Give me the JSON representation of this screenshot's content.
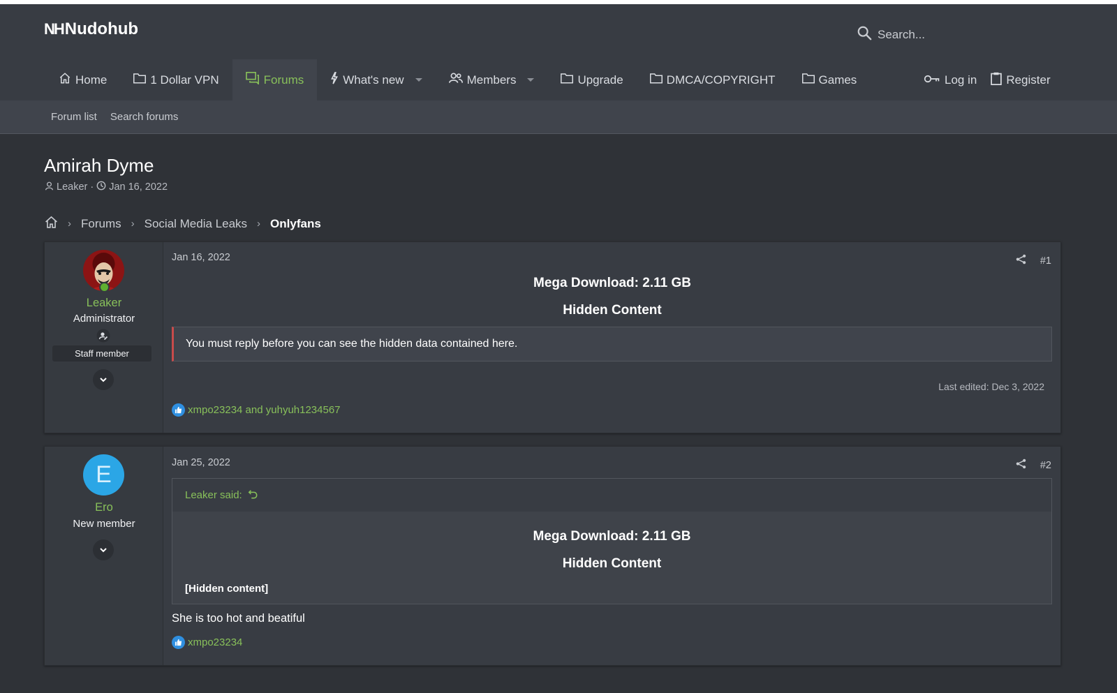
{
  "site": {
    "logo_mark": "NH",
    "logo_text": "Nudohub"
  },
  "search": {
    "placeholder": "Search..."
  },
  "nav": {
    "items": [
      {
        "label": "Home",
        "icon": "home-icon"
      },
      {
        "label": "1 Dollar VPN",
        "icon": "folder-icon"
      },
      {
        "label": "Forums",
        "icon": "forums-icon",
        "active": true
      },
      {
        "label": "What's new",
        "icon": "bolt-icon",
        "dropdown": true
      },
      {
        "label": "Members",
        "icon": "members-icon",
        "dropdown": true
      },
      {
        "label": "Upgrade",
        "icon": "folder-icon"
      },
      {
        "label": "DMCA/COPYRIGHT",
        "icon": "folder-icon"
      },
      {
        "label": "Games",
        "icon": "folder-icon"
      }
    ],
    "login": "Log in",
    "register": "Register"
  },
  "subnav": {
    "forum_list": "Forum list",
    "search_forums": "Search forums"
  },
  "thread": {
    "title": "Amirah Dyme",
    "author": "Leaker",
    "separator": "·",
    "date": "Jan 16, 2022"
  },
  "breadcrumb": {
    "items": [
      "Forums",
      "Social Media Leaks",
      "Onlyfans"
    ]
  },
  "posts": [
    {
      "username": "Leaker",
      "user_title": "Administrator",
      "badge": "Staff member",
      "date": "Jan 16, 2022",
      "number": "#1",
      "headline": "Mega Download: 2.11 GB",
      "subheadline": "Hidden Content",
      "hidden_notice": "You must reply before you can see the hidden data contained here.",
      "last_edited": "Last edited: Dec 3, 2022",
      "reactions": "xmpo23234 and yuhyuh1234567"
    },
    {
      "username": "Ero",
      "avatar_letter": "E",
      "user_title": "New member",
      "date": "Jan 25, 2022",
      "number": "#2",
      "quote_author": "Leaker said:",
      "quote_headline": "Mega Download: 2.11 GB",
      "quote_subheadline": "Hidden Content",
      "quote_hidden": "[Hidden content]",
      "body": "She is too hot and beatiful",
      "reactions": "xmpo23234"
    }
  ],
  "colors": {
    "accent": "#88c05a",
    "background": "#2f3237",
    "header": "#383c43",
    "like": "#2f8fe0",
    "avatar_e": "#2ba6e6",
    "hidden_border": "#c84b4b"
  }
}
